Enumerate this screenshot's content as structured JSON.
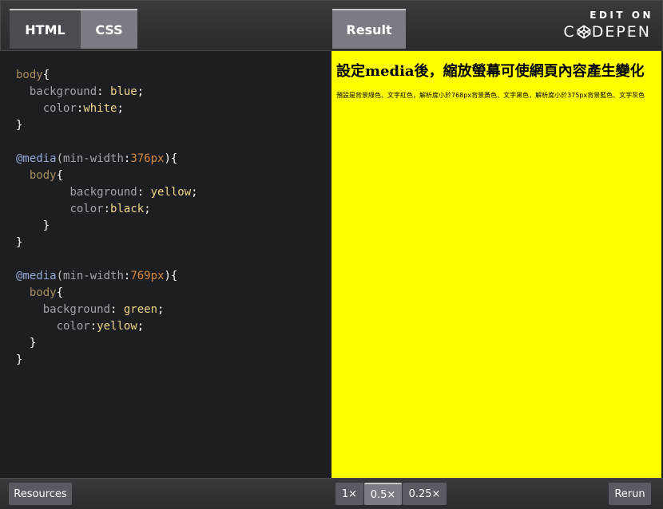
{
  "header": {
    "tabs": [
      {
        "label": "HTML"
      },
      {
        "label": "CSS"
      },
      {
        "label": "Result"
      }
    ],
    "edit_on": "EDIT ON",
    "brand_prefix": "C",
    "brand_suffix": "DEPEN"
  },
  "code": {
    "lines": [
      [
        {
          "t": "body",
          "c": "sel"
        },
        {
          "t": "{",
          "c": "punc"
        }
      ],
      [
        {
          "t": "  ",
          "c": "punc"
        },
        {
          "t": "background",
          "c": "prop"
        },
        {
          "t": ": ",
          "c": "punc"
        },
        {
          "t": "blue",
          "c": "val"
        },
        {
          "t": ";",
          "c": "punc"
        }
      ],
      [
        {
          "t": "    ",
          "c": "punc"
        },
        {
          "t": "color",
          "c": "prop"
        },
        {
          "t": ":",
          "c": "punc"
        },
        {
          "t": "white",
          "c": "val"
        },
        {
          "t": ";",
          "c": "punc"
        }
      ],
      [
        {
          "t": "}",
          "c": "punc"
        }
      ],
      [],
      [
        {
          "t": "@media",
          "c": "at"
        },
        {
          "t": "(",
          "c": "paren"
        },
        {
          "t": "min-width",
          "c": "prop"
        },
        {
          "t": ":",
          "c": "punc"
        },
        {
          "t": "376px",
          "c": "num"
        },
        {
          "t": "){",
          "c": "punc"
        }
      ],
      [
        {
          "t": "  ",
          "c": "punc"
        },
        {
          "t": "body",
          "c": "sel"
        },
        {
          "t": "{",
          "c": "punc"
        }
      ],
      [
        {
          "t": "        ",
          "c": "punc"
        },
        {
          "t": "background",
          "c": "prop"
        },
        {
          "t": ": ",
          "c": "punc"
        },
        {
          "t": "yellow",
          "c": "val"
        },
        {
          "t": ";",
          "c": "punc"
        }
      ],
      [
        {
          "t": "        ",
          "c": "punc"
        },
        {
          "t": "color",
          "c": "prop"
        },
        {
          "t": ":",
          "c": "punc"
        },
        {
          "t": "black",
          "c": "val"
        },
        {
          "t": ";",
          "c": "punc"
        }
      ],
      [
        {
          "t": "    }",
          "c": "punc"
        }
      ],
      [
        {
          "t": "}",
          "c": "punc"
        }
      ],
      [],
      [
        {
          "t": "@media",
          "c": "at"
        },
        {
          "t": "(",
          "c": "paren"
        },
        {
          "t": "min-width",
          "c": "prop"
        },
        {
          "t": ":",
          "c": "punc"
        },
        {
          "t": "769px",
          "c": "num"
        },
        {
          "t": "){",
          "c": "punc"
        }
      ],
      [
        {
          "t": "  ",
          "c": "punc"
        },
        {
          "t": "body",
          "c": "sel"
        },
        {
          "t": "{",
          "c": "punc"
        }
      ],
      [
        {
          "t": "    ",
          "c": "punc"
        },
        {
          "t": "background",
          "c": "prop"
        },
        {
          "t": ": ",
          "c": "punc"
        },
        {
          "t": "green",
          "c": "val"
        },
        {
          "t": ";",
          "c": "punc"
        }
      ],
      [
        {
          "t": "      ",
          "c": "punc"
        },
        {
          "t": "color",
          "c": "prop"
        },
        {
          "t": ":",
          "c": "punc"
        },
        {
          "t": "yellow",
          "c": "val"
        },
        {
          "t": ";",
          "c": "punc"
        }
      ],
      [
        {
          "t": "  }",
          "c": "punc"
        }
      ],
      [
        {
          "t": "}",
          "c": "punc"
        }
      ]
    ]
  },
  "result": {
    "heading": "設定media後，縮放螢幕可使網頁內容產生變化",
    "paragraph": "預設是背景綠色、文字紅色，解析度小於768px背景黃色、文字黑色，解析度小於375px背景藍色、文字灰色"
  },
  "footer": {
    "resources_label": "Resources",
    "zoom_options": [
      "1×",
      "0.5×",
      "0.25×"
    ],
    "zoom_selected": "0.5×",
    "rerun_label": "Rerun"
  },
  "colors": {
    "result_background": "#ffff00",
    "editor_background": "#1d1e22",
    "selector": "#a88f5e",
    "property": "#a3a3ad",
    "value": "#f0d68a",
    "at_rule": "#94a8d6",
    "number": "#d6893d"
  }
}
